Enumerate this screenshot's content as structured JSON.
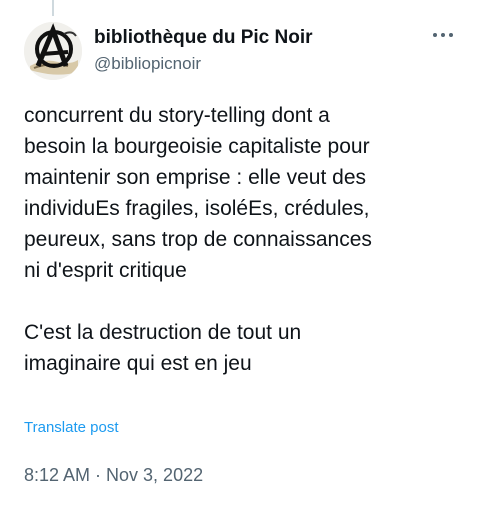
{
  "author": {
    "display_name": "bibliothèque du Pic Noir",
    "handle": "@bibliopicnoir",
    "avatar_icon": "anarchy-a-avatar"
  },
  "more_icon": "more-horizontal-icon",
  "tweet": {
    "paragraph1_lines": [
      "concurrent du story-telling dont a",
      "besoin la bourgeoisie capitaliste pour",
      "maintenir son emprise : elle veut des",
      "individuEs fragiles, isoléEs, crédules,",
      "peureux, sans trop de connaissances",
      "ni d'esprit critique"
    ],
    "paragraph2_lines": [
      "C'est la destruction de tout un",
      "imaginaire qui est en jeu"
    ]
  },
  "translate_label": "Translate post",
  "timestamp": "8:12 AM · Nov 3, 2022",
  "colors": {
    "text": "#0f1419",
    "secondary": "#536471",
    "link": "#1d9bf0"
  }
}
